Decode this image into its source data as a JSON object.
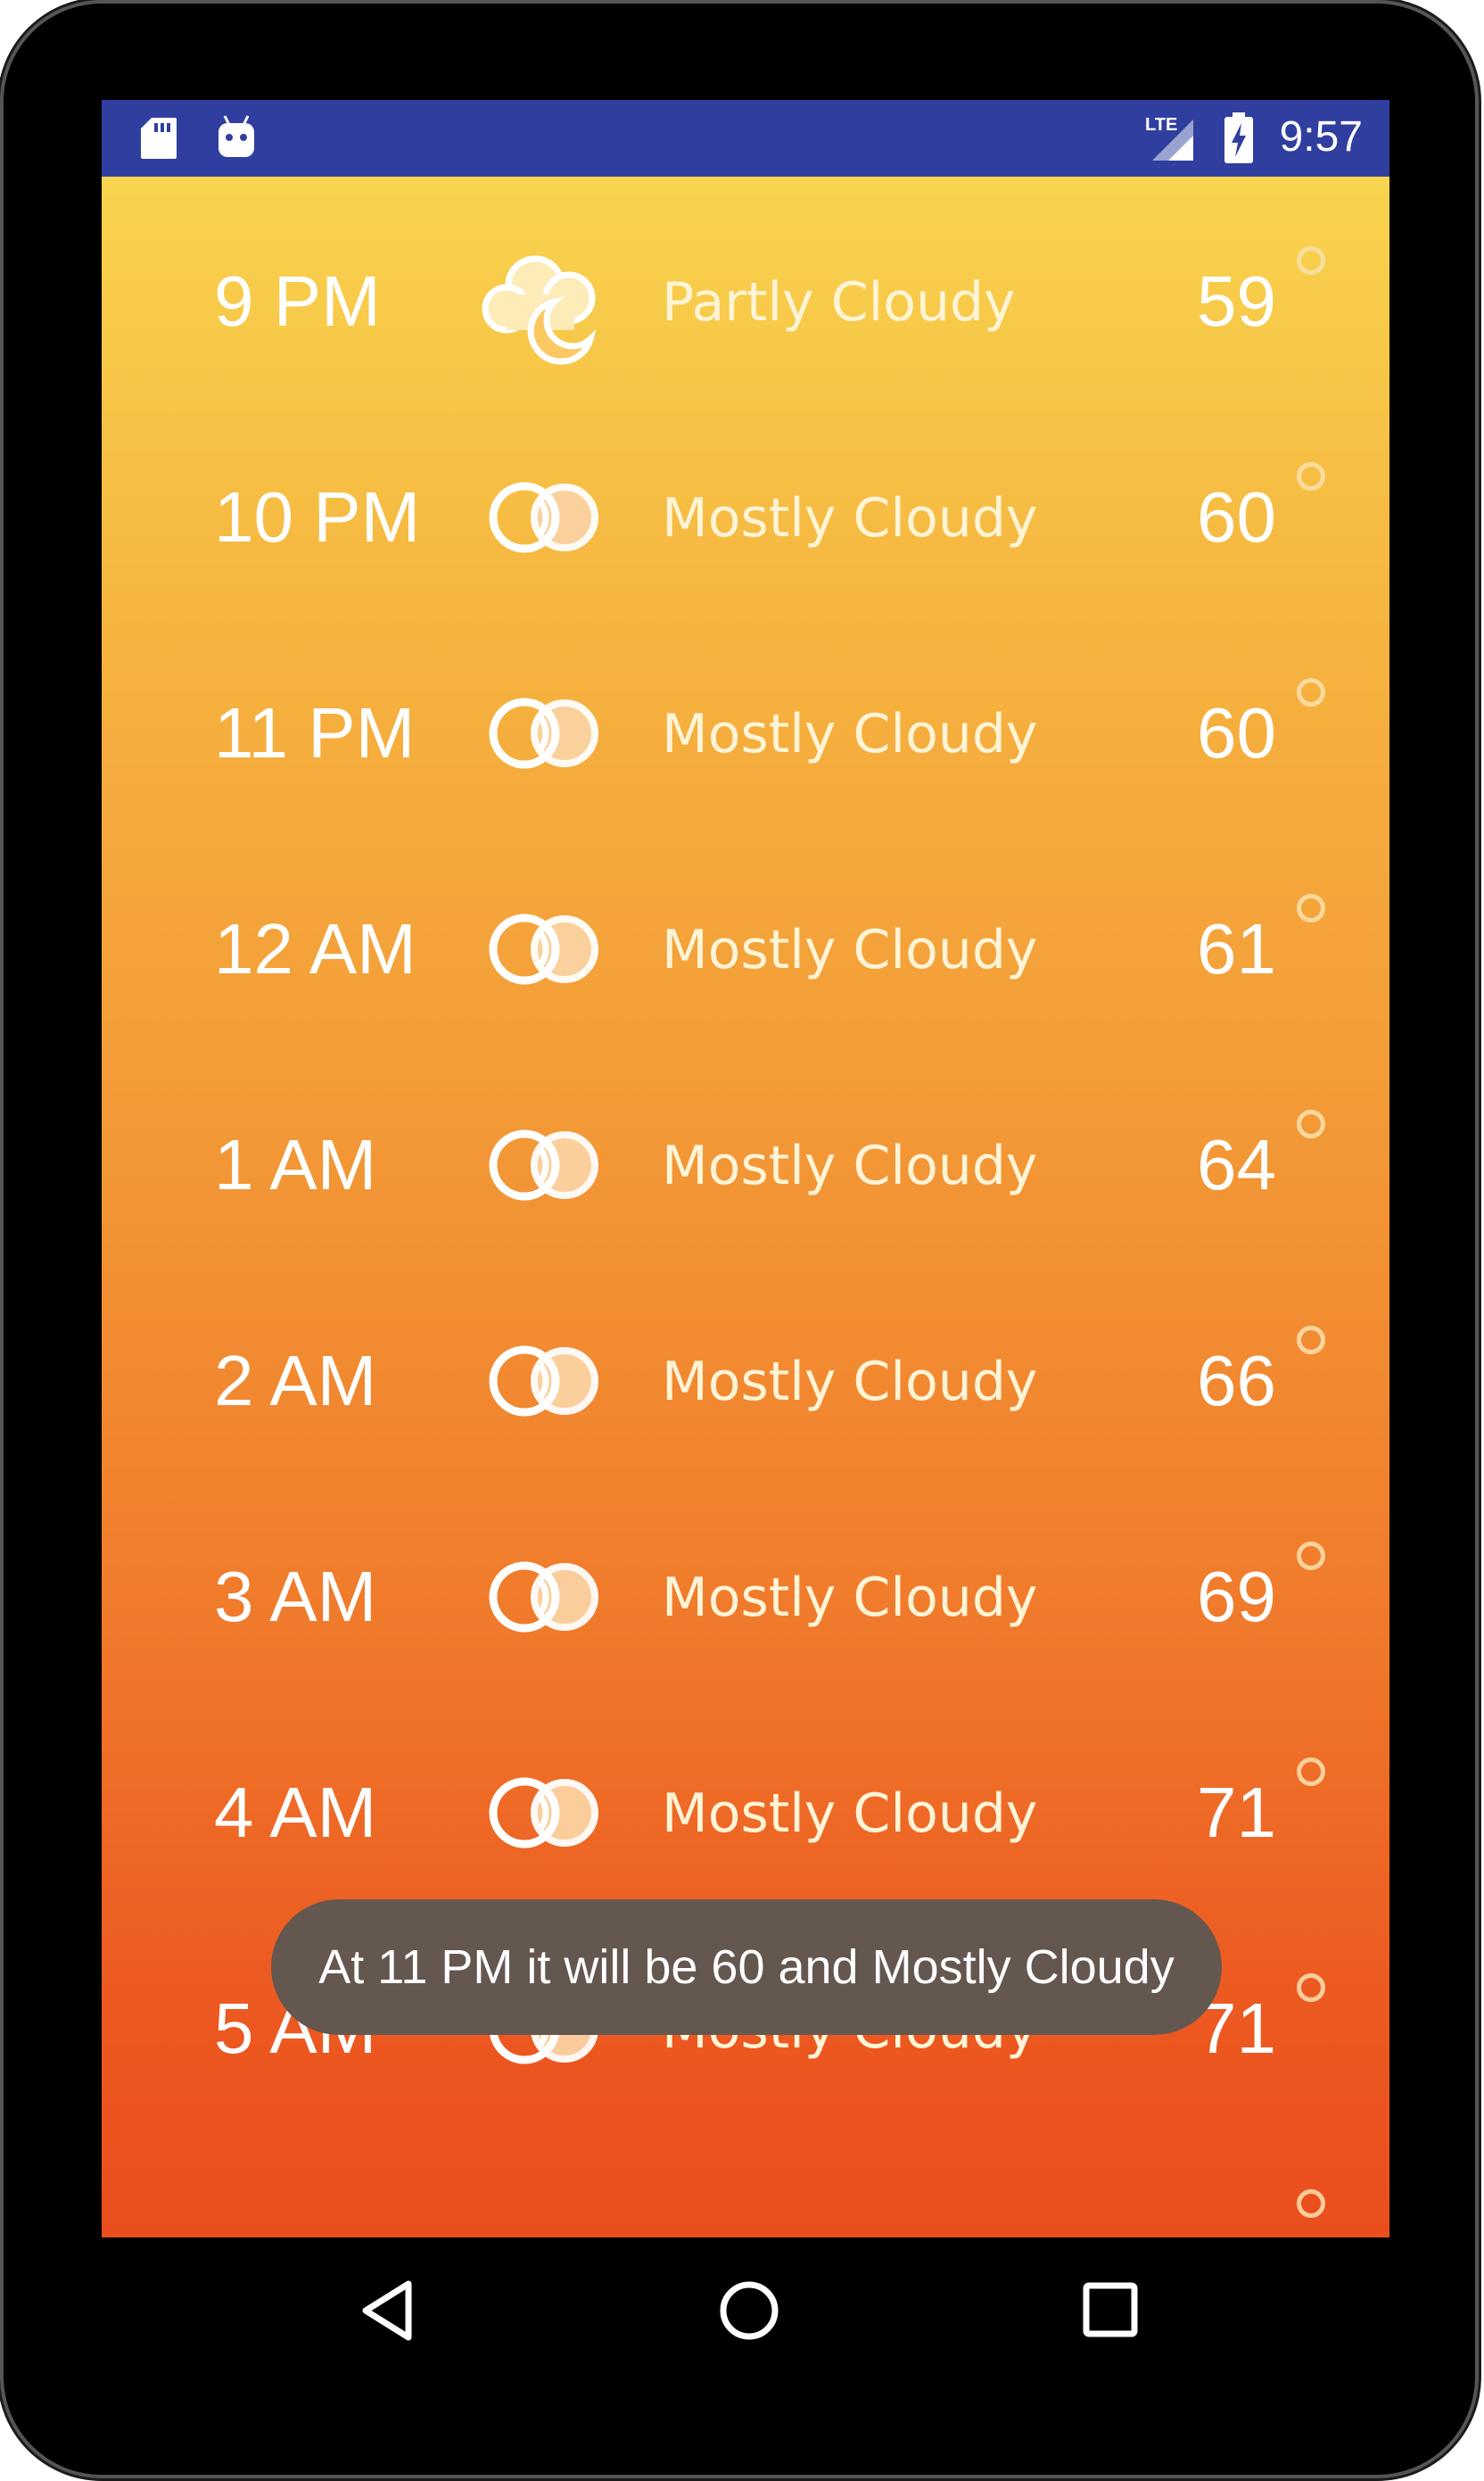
{
  "status_bar": {
    "time": "9:57",
    "network_label": "LTE",
    "icons": [
      "sd-card-icon",
      "android-icon",
      "lte-signal-icon",
      "battery-charging-icon"
    ]
  },
  "forecast": [
    {
      "time": "9 PM",
      "icon": "partly-cloudy-night-icon",
      "condition": "Partly Cloudy",
      "temp": "59"
    },
    {
      "time": "10 PM",
      "icon": "mostly-cloudy-icon",
      "condition": "Mostly Cloudy",
      "temp": "60"
    },
    {
      "time": "11 PM",
      "icon": "mostly-cloudy-icon",
      "condition": "Mostly Cloudy",
      "temp": "60"
    },
    {
      "time": "12 AM",
      "icon": "mostly-cloudy-icon",
      "condition": "Mostly Cloudy",
      "temp": "61"
    },
    {
      "time": "1 AM",
      "icon": "mostly-cloudy-icon",
      "condition": "Mostly Cloudy",
      "temp": "64"
    },
    {
      "time": "2 AM",
      "icon": "mostly-cloudy-icon",
      "condition": "Mostly Cloudy",
      "temp": "66"
    },
    {
      "time": "3 AM",
      "icon": "mostly-cloudy-icon",
      "condition": "Mostly Cloudy",
      "temp": "69"
    },
    {
      "time": "4 AM",
      "icon": "mostly-cloudy-icon",
      "condition": "Mostly Cloudy",
      "temp": "71"
    },
    {
      "time": "5 AM",
      "icon": "mostly-cloudy-icon",
      "condition": "Mostly Cloudy",
      "temp": "71"
    }
  ],
  "toast": {
    "message": "At 11 PM it will be 60 and Mostly Cloudy"
  },
  "nav_bar": {
    "buttons": [
      "back-icon",
      "home-icon",
      "recents-icon"
    ]
  },
  "colors": {
    "status_bar": "#303F9F",
    "gradient_top": "#F8D44E",
    "gradient_bottom": "#EA4E1E",
    "toast_bg": "#645750"
  }
}
